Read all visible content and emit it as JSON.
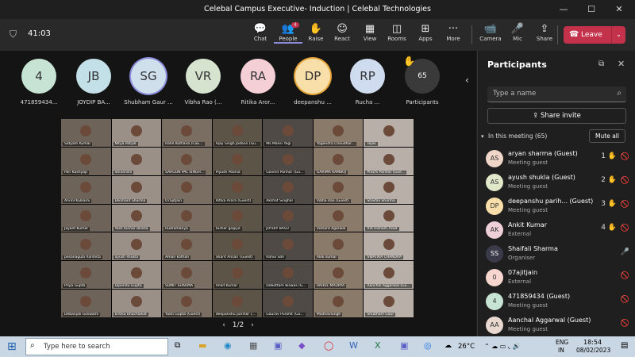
{
  "title": "Celebal Campus Executive- Induction | Celebal Technologies",
  "timer": "41:03",
  "toolbar": [
    {
      "label": "Chat",
      "icon": "chat-icon",
      "g": "💬"
    },
    {
      "label": "People",
      "icon": "people-icon",
      "g": "👥",
      "badge": "4"
    },
    {
      "label": "Raise",
      "icon": "raise-hand-icon",
      "g": "✋"
    },
    {
      "label": "React",
      "icon": "react-icon",
      "g": "☺"
    },
    {
      "label": "View",
      "icon": "view-icon",
      "g": "▦"
    },
    {
      "label": "Rooms",
      "icon": "rooms-icon",
      "g": "◫"
    },
    {
      "label": "Apps",
      "icon": "apps-icon",
      "g": "⊞"
    },
    {
      "label": "More",
      "icon": "more-icon",
      "g": "···"
    },
    {
      "label": "Camera",
      "icon": "camera-icon",
      "g": "📹"
    },
    {
      "label": "Mic",
      "icon": "mic-icon",
      "g": "🎤"
    },
    {
      "label": "Share",
      "icon": "share-icon",
      "g": "⇪"
    }
  ],
  "leave_label": "Leave",
  "avatars": [
    {
      "initials": "4",
      "label": "471859434...",
      "color": "#c7e3d3"
    },
    {
      "initials": "JB",
      "label": "JOYDIP BA...",
      "color": "#c3e0e8"
    },
    {
      "initials": "SG",
      "label": "Shubham Gaur ...",
      "color": "#cfe0ec"
    },
    {
      "initials": "VR",
      "label": "Vibha Rao (...",
      "color": "#d6e4cf"
    },
    {
      "initials": "RA",
      "label": "Ritika Aror...",
      "color": "#f4cfd5"
    },
    {
      "initials": "DP",
      "label": "deepanshu ...",
      "color": "#f8dfa9"
    },
    {
      "initials": "RP",
      "label": "Rucha ...",
      "color": "#cfdcef"
    },
    {
      "initials": "65",
      "label": "Participants",
      "color": "#3a3a3a"
    }
  ],
  "grid_names": [
    "Satyam Kumar",
    "Nitya Patyal",
    "Rahil Kothana (CSE...",
    "Ajay Singh Jadoun (Gu...",
    "Ms.Mansi Yogi",
    "Yogendra Choudhar...",
    "Tejas",
    "Pari Kashyap",
    "Shivanshi",
    "SARGUN PAL SINGH...",
    "Piyush Poonia",
    "Govind Parihar (Gu...",
    "GARIMA KAMBOJ",
    "Prachi Parihar (Gue...",
    "Arvinl Kulkarni",
    "Dikshant Sharma",
    "07ajitjain",
    "Ritika Arora (Guest)",
    "Akshat Singhal",
    "Vibha Rao (Guest)",
    "Shaifali Sharma",
    "Jayant Kumar",
    "Yash Kumar Bhatia",
    "Rudramanya",
    "tushar gogiya",
    "JOYDIP BASU",
    "Vishant Agarwal",
    "md Hisham Asad",
    "pesanagula harshita",
    "ayush shukla",
    "Aman kothari",
    "Sharif Ansari (Guest)",
    "Rahul Sah",
    "Alok kumar",
    "SWATIKA CHANDRA",
    "Priya Gupta",
    "Dipendu Gupta",
    "SUMIT SHARMA",
    "Ankit Kumar",
    "Debottam Biswas (G...",
    "RAHUL MAURYA",
    "Aanchal Aggarwal (Gu...",
    "Debanjali Goswami",
    "kritika bhachawat",
    "Yukti Gupta (Guest)",
    "deepanshu parihar (...",
    "Gaurav Purohit (Gu...",
    "MadhavSingh",
    "Shubham Gaur"
  ],
  "pager": "1/2",
  "panel": {
    "title": "Participants",
    "search_placeholder": "Type a name",
    "share_invite": "Share invite",
    "section": "In this meeting (65)",
    "mute_all": "Mute all",
    "people": [
      {
        "initials": "AS",
        "name": "aryan sharma (Guest)",
        "role": "Meeting guest",
        "hand": "1",
        "color": "#f0d6c8"
      },
      {
        "initials": "AS",
        "name": "ayush shukla (Guest)",
        "role": "Meeting guest",
        "hand": "2",
        "color": "#dfe8c9"
      },
      {
        "initials": "DP",
        "name": "deepanshu parih... (Guest)",
        "role": "Meeting guest",
        "hand": "3",
        "color": "#f8dfa9"
      },
      {
        "initials": "AK",
        "name": "Ankit Kumar",
        "role": "External",
        "hand": "4",
        "color": "#f0d0d8"
      },
      {
        "initials": "SS",
        "name": "Shaifali Sharma",
        "role": "Organiser",
        "hand": "",
        "color": "#3a3a4a"
      },
      {
        "initials": "0",
        "name": "07ajitjain",
        "role": "External",
        "hand": "",
        "color": "#f6d6cf"
      },
      {
        "initials": "4",
        "name": "471859434 (Guest)",
        "role": "Meeting guest",
        "hand": "",
        "color": "#c7e3d3"
      },
      {
        "initials": "AA",
        "name": "Aanchal Aggarwal (Guest)",
        "role": "Meeting guest",
        "hand": "",
        "color": "#e8d8d0"
      }
    ]
  },
  "taskbar": {
    "search_placeholder": "Type here to search",
    "weather": "26°C",
    "lang1": "ENG",
    "lang2": "IN",
    "time": "18:54",
    "date": "08/02/2023"
  }
}
